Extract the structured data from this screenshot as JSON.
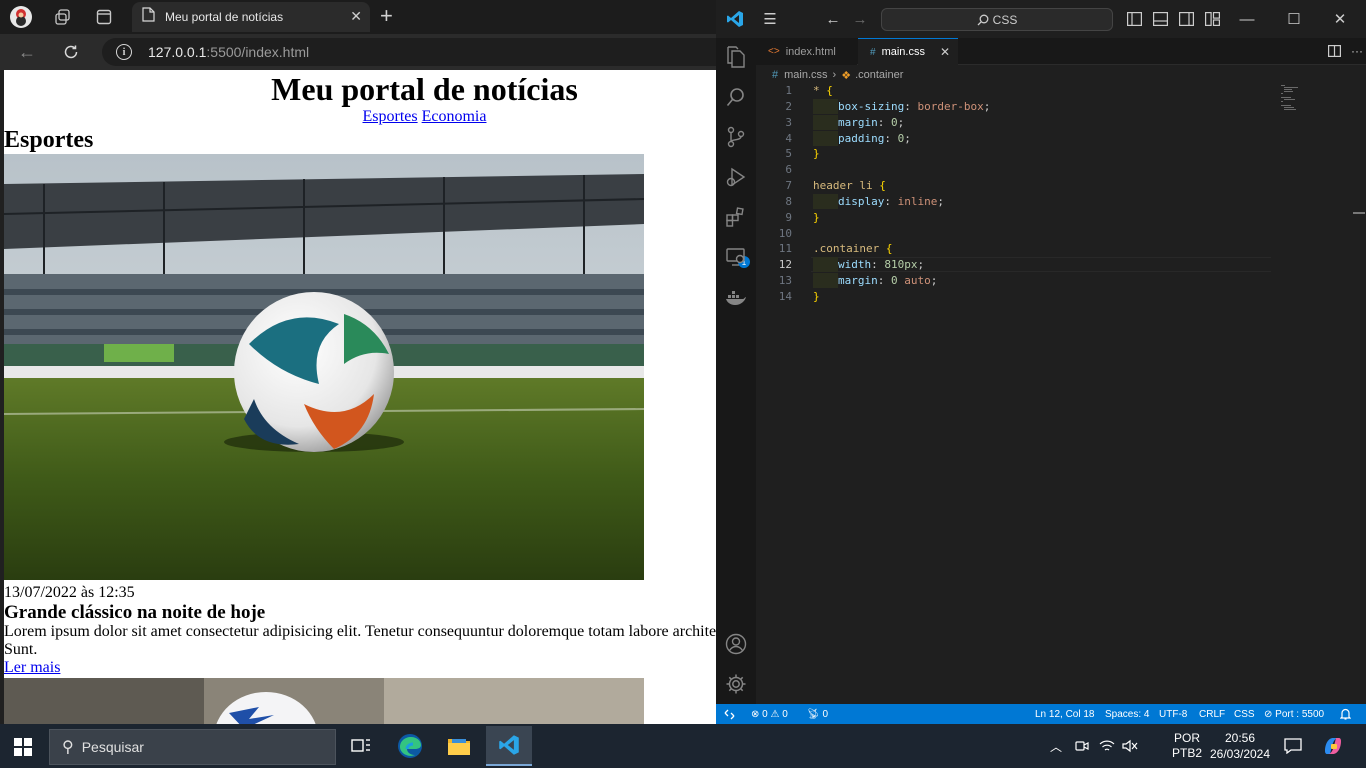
{
  "browser": {
    "tab_title": "Meu portal de notícias",
    "url_host": "127.0.0.1",
    "url_rest": ":5500/index.html",
    "page": {
      "title": "Meu portal de notícias",
      "nav": [
        "Esportes",
        "Economia"
      ],
      "section": "Esportes",
      "article": {
        "date": "13/07/2022 às 12:35",
        "headline": "Grande clássico na noite de hoje",
        "text": "Lorem ipsum dolor sit amet consectetur adipisicing elit. Tenetur consequuntur doloremque totam labore architecto. Laborum, modi itaque. Sunt.",
        "link": "Ler mais"
      }
    }
  },
  "vscode": {
    "search": "CSS",
    "tabs": [
      "index.html",
      "main.css"
    ],
    "breadcrumb": {
      "file": "main.css",
      "symbol": ".container"
    },
    "code": [
      {
        "n": "1",
        "parts": [
          [
            "sel",
            "* "
          ],
          [
            "brace",
            "{"
          ]
        ]
      },
      {
        "n": "2",
        "indent": true,
        "parts": [
          [
            "prop",
            "box-sizing"
          ],
          [
            "punc",
            ": "
          ],
          [
            "val",
            "border-box"
          ],
          [
            "punc",
            ";"
          ]
        ]
      },
      {
        "n": "3",
        "indent": true,
        "parts": [
          [
            "prop",
            "margin"
          ],
          [
            "punc",
            ": "
          ],
          [
            "num",
            "0"
          ],
          [
            "punc",
            ";"
          ]
        ]
      },
      {
        "n": "4",
        "indent": true,
        "parts": [
          [
            "prop",
            "padding"
          ],
          [
            "punc",
            ": "
          ],
          [
            "num",
            "0"
          ],
          [
            "punc",
            ";"
          ]
        ]
      },
      {
        "n": "5",
        "parts": [
          [
            "brace",
            "}"
          ]
        ]
      },
      {
        "n": "6",
        "parts": []
      },
      {
        "n": "7",
        "parts": [
          [
            "sel",
            "header li "
          ],
          [
            "brace",
            "{"
          ]
        ]
      },
      {
        "n": "8",
        "indent": true,
        "parts": [
          [
            "prop",
            "display"
          ],
          [
            "punc",
            ": "
          ],
          [
            "val",
            "inline"
          ],
          [
            "punc",
            ";"
          ]
        ]
      },
      {
        "n": "9",
        "parts": [
          [
            "brace",
            "}"
          ]
        ]
      },
      {
        "n": "10",
        "parts": []
      },
      {
        "n": "11",
        "parts": [
          [
            "sel",
            ".container "
          ],
          [
            "brace",
            "{"
          ]
        ]
      },
      {
        "n": "12",
        "indent": true,
        "current": true,
        "parts": [
          [
            "prop",
            "width"
          ],
          [
            "punc",
            ": "
          ],
          [
            "num",
            "810px"
          ],
          [
            "punc",
            ";"
          ]
        ]
      },
      {
        "n": "13",
        "indent": true,
        "parts": [
          [
            "prop",
            "margin"
          ],
          [
            "punc",
            ": "
          ],
          [
            "num",
            "0"
          ],
          [
            "punc",
            " "
          ],
          [
            "val",
            "auto"
          ],
          [
            "punc",
            ";"
          ]
        ]
      },
      {
        "n": "14",
        "parts": [
          [
            "brace",
            "}"
          ]
        ]
      }
    ],
    "status": {
      "errors": "0",
      "warnings": "0",
      "ports": "0",
      "position": "Ln 12, Col 18",
      "spaces": "Spaces: 4",
      "encoding": "UTF-8",
      "eol": "CRLF",
      "language": "CSS",
      "port": "Port : 5500"
    },
    "extensions_badge": "1"
  },
  "taskbar": {
    "search_placeholder": "Pesquisar",
    "lang_top": "POR",
    "lang_bottom": "PTB2",
    "time": "20:56",
    "date": "26/03/2024"
  },
  "colors": {
    "vscode_accent": "#0078d4",
    "link": "#0000ee",
    "edge_blue": "#0c59a4",
    "folder": "#f0b429"
  }
}
